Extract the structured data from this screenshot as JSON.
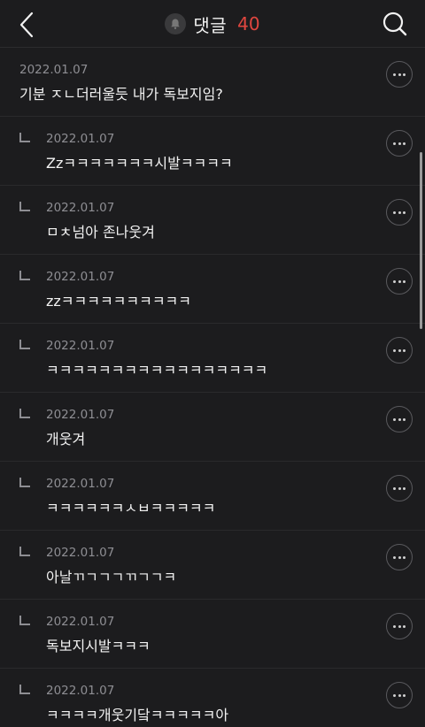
{
  "header": {
    "title": "댓글",
    "count": "40",
    "back_icon": "chevron-left-icon",
    "bell_icon": "bell-icon",
    "search_icon": "search-icon"
  },
  "colors": {
    "background": "#1c1c1e",
    "accent": "#e0463f",
    "secondary_text": "#8e8e93"
  },
  "comments": [
    {
      "date": "2022.01.07",
      "text": "기분 ㅈㄴ더러울듯 내가 독보지임?",
      "reply": false
    },
    {
      "date": "2022.01.07",
      "text": "Zzㅋㅋㅋㅋㅋㅋㅋ시발ㅋㅋㅋㅋ",
      "reply": true
    },
    {
      "date": "2022.01.07",
      "text": "ㅁㅊ넘아 존나웃겨",
      "reply": true
    },
    {
      "date": "2022.01.07",
      "text": "zzㅋㅋㅋㅋㅋㅋㅋㅋㅋㅋ",
      "reply": true
    },
    {
      "date": "2022.01.07",
      "text": "ㅋㅋㅋㅋㅋㅋㅋㅋㅋㅋㅋㅋㅋㅋㅋㅋㅋ",
      "reply": true
    },
    {
      "date": "2022.01.07",
      "text": "개웃겨",
      "reply": true
    },
    {
      "date": "2022.01.07",
      "text": "ㅋㅋㅋㅋㅋㅋㅅㅂㅋㅋㅋㅋㅋ",
      "reply": true
    },
    {
      "date": "2022.01.07",
      "text": "아날ㄲㄱㄱㄱㄲㄱㄱㅋ",
      "reply": true
    },
    {
      "date": "2022.01.07",
      "text": "독보지시발ㅋㅋㅋ",
      "reply": true
    },
    {
      "date": "2022.01.07",
      "text": "ㅋㅋㅋㅋ개웃기닼ㅋㅋㅋㅋㅋ아",
      "reply": true
    }
  ]
}
